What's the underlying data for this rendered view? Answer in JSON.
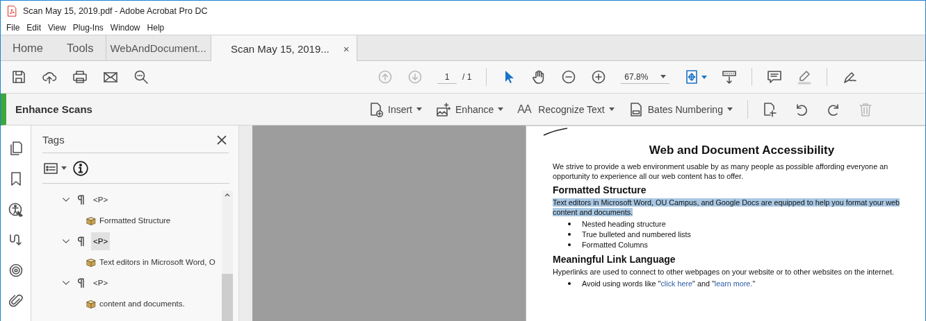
{
  "window": {
    "title": "Scan May 15, 2019.pdf - Adobe Acrobat Pro DC"
  },
  "menu": [
    "File",
    "Edit",
    "View",
    "Plug-Ins",
    "Window",
    "Help"
  ],
  "tabs": [
    {
      "label": "Home",
      "kind": "nav",
      "selected": false
    },
    {
      "label": "Tools",
      "kind": "nav",
      "selected": false
    },
    {
      "label": "WebAndDocument...",
      "kind": "document",
      "selected": false
    },
    {
      "label": "Scan May 15, 2019...",
      "kind": "document",
      "selected": true,
      "close": "×"
    }
  ],
  "toolbar": {
    "page": "1",
    "page_total": "/ 1",
    "zoom": "67.8%"
  },
  "tool_panel": {
    "title": "Enhance Scans",
    "items": [
      {
        "label": "Insert",
        "kind": "insert"
      },
      {
        "label": "Enhance",
        "kind": "enhance"
      },
      {
        "label": "Recognize Text",
        "kind": "ocr",
        "glyph": "AA"
      },
      {
        "label": "Bates Numbering",
        "kind": "bates"
      }
    ]
  },
  "tags_panel": {
    "title": "Tags",
    "tree": [
      {
        "label": "<P>",
        "expanded": true,
        "selected": false,
        "children": [
          {
            "label": "Formatted Structure"
          }
        ]
      },
      {
        "label": "<P>",
        "expanded": true,
        "selected": true,
        "children": [
          {
            "label": "Text editors in Microsoft Word, O"
          }
        ]
      },
      {
        "label": "<P>",
        "expanded": true,
        "selected": false,
        "children": [
          {
            "label": "content and documents."
          }
        ]
      }
    ]
  },
  "document": {
    "blocks": [
      {
        "kind": "title",
        "text": "Web and Document Accessibility"
      },
      {
        "kind": "paragraph",
        "text": "We strive to provide a web environment usable by as many people as possible affording everyone an opportunity to experience all our web content has to offer.",
        "highlighted": false
      },
      {
        "kind": "heading",
        "text": "Formatted Structure"
      },
      {
        "kind": "paragraph",
        "text": "Text editors in Microsoft Word, OU Campus, and Google Docs are equipped to help you format your web content and documents.",
        "highlighted": true
      },
      {
        "kind": "bullet",
        "parts": [
          {
            "text": "Nested heading structure",
            "kind": "text"
          }
        ]
      },
      {
        "kind": "bullet",
        "parts": [
          {
            "text": "True bulleted and numbered lists",
            "kind": "text"
          }
        ]
      },
      {
        "kind": "bullet",
        "parts": [
          {
            "text": "Formatted Columns",
            "kind": "text"
          }
        ]
      },
      {
        "kind": "heading",
        "text": "Meaningful Link Language"
      },
      {
        "kind": "paragraph",
        "text": "Hyperlinks are used to connect to other webpages on your website or to other websites on the internet.",
        "highlighted": false
      },
      {
        "kind": "bullet",
        "parts": [
          {
            "text": "Avoid using words like \"",
            "kind": "text"
          },
          {
            "text": "click here",
            "kind": "link"
          },
          {
            "text": "\" and \"",
            "kind": "text"
          },
          {
            "text": "learn more.",
            "kind": "link"
          },
          {
            "text": "\"",
            "kind": "text"
          }
        ]
      }
    ]
  }
}
